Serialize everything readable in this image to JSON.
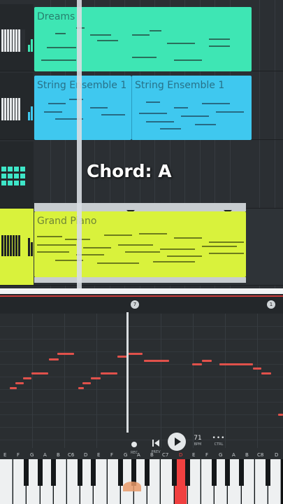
{
  "arrangement": {
    "chord_label": "Chord: A",
    "tracks": [
      {
        "clips": [
          {
            "name": "Dreams",
            "color": "#3ee6b4"
          }
        ]
      },
      {
        "clips": [
          {
            "name": "String Ensemble 1",
            "color": "#3fc8ef"
          },
          {
            "name": "String Ensemble 1",
            "color": "#3fc8ef"
          }
        ]
      },
      {
        "clips": []
      },
      {
        "clips": [
          {
            "name": "Grand Piano",
            "color": "#d9f23c"
          }
        ]
      }
    ]
  },
  "timeline": {
    "markers": [
      "7",
      "1"
    ]
  },
  "transport": {
    "rec": "REC",
    "prev": "PREV",
    "bpm_value": "71",
    "bpm_label": "BPM",
    "ctrl_label": "CTRL"
  },
  "keyboard": {
    "labels": [
      "E",
      "F",
      "G",
      "A",
      "B",
      "C6",
      "D",
      "E",
      "F",
      "G",
      "A",
      "B",
      "C7",
      "D",
      "E",
      "F",
      "G",
      "A",
      "B",
      "C8",
      "D"
    ],
    "active_note": "D"
  },
  "colors": {
    "note": "#e0514b",
    "playhead": "#d9dde0",
    "active_key": "#f04040"
  }
}
